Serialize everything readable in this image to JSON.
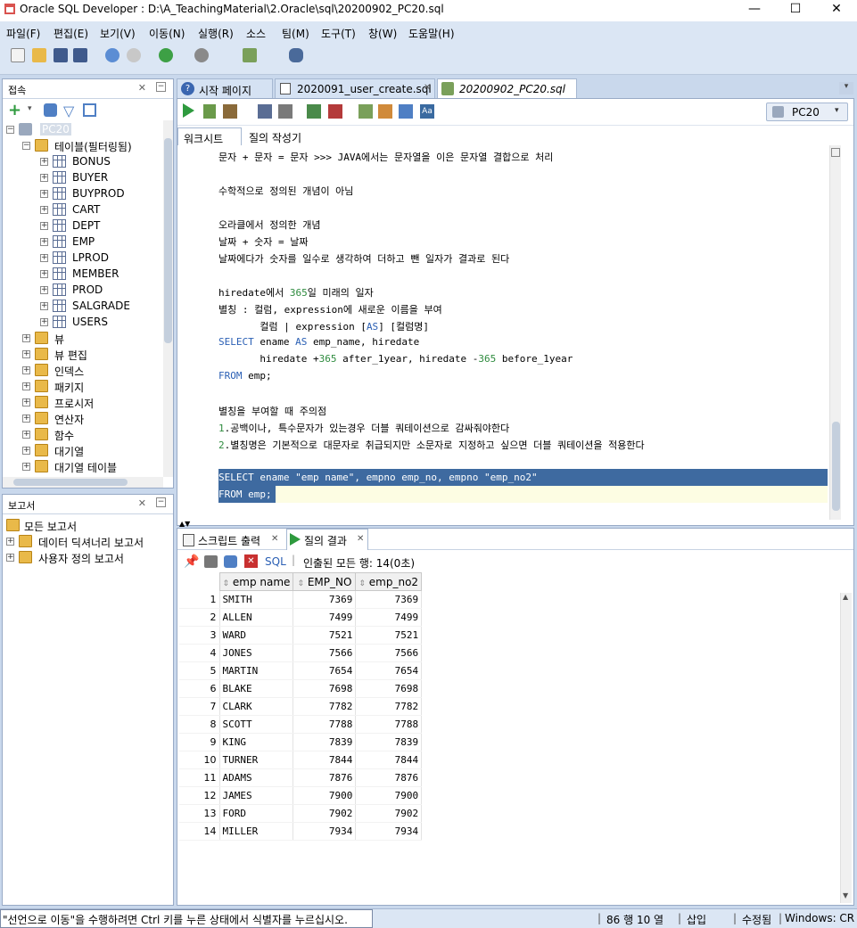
{
  "window": {
    "title": "Oracle SQL Developer : D:\\A_TeachingMaterial\\2.Oracle\\sql\\20200902_PC20.sql",
    "minimize": "—",
    "maximize": "☐",
    "close": "✕"
  },
  "menu": [
    "파일(F)",
    "편집(E)",
    "보기(V)",
    "이동(N)",
    "실행(R)",
    "소스",
    "팀(M)",
    "도구(T)",
    "창(W)",
    "도움말(H)"
  ],
  "connections_panel": {
    "title": "접속",
    "root": "PC20",
    "tables_node": "테이블(필터링됨)",
    "tables": [
      "BONUS",
      "BUYER",
      "BUYPROD",
      "CART",
      "DEPT",
      "EMP",
      "LPROD",
      "MEMBER",
      "PROD",
      "SALGRADE",
      "USERS"
    ],
    "other_nodes": [
      "뷰",
      "뷰 편집",
      "인덱스",
      "패키지",
      "프로시저",
      "연산자",
      "함수",
      "대기열",
      "대기열 테이블"
    ]
  },
  "reports_panel": {
    "title": "보고서",
    "items": [
      "모든 보고서",
      "데이터 딕셔너리 보고서",
      "사용자 정의 보고서"
    ]
  },
  "editor_tabs": [
    "시작 페이지",
    "2020091_user_create.sql",
    "20200902_PC20.sql"
  ],
  "connection_selector": "PC20",
  "subtabs": [
    "워크시트",
    "질의 작성기"
  ],
  "code_lines": [
    {
      "text": "문자 + 문자 = 문자 >>> JAVA에서는 문자열을 이은 문자열 결합으로 처리"
    },
    {
      "text": ""
    },
    {
      "text": "수학적으로 정의된 개념이 아님"
    },
    {
      "text": ""
    },
    {
      "text": "오라클에서 정의한 개념"
    },
    {
      "text": "날짜 + 숫자 = 날짜"
    },
    {
      "text": "날짜에다가 숫자를 일수로 생각하여 더하고 뺀 일자가 결과로 된다"
    },
    {
      "text": ""
    },
    {
      "text": "hiredate에서 365일 미래의 일자"
    },
    {
      "text": "별칭 : 컬럼, expression에 새로운 이름을 부여"
    },
    {
      "text": "       컬럼 | expression [AS] [컬럼명]"
    },
    {
      "text": "SELECT ename AS emp_name, hiredate"
    },
    {
      "text": "       hiredate +365 after_1year, hiredate -365 before_1year"
    },
    {
      "text": "FROM emp;"
    },
    {
      "text": ""
    },
    {
      "text": "별칭을 부여할 때 주의점"
    },
    {
      "text": "1.공백이나, 특수문자가 있는경우 더블 쿼테이션으로 감싸줘야한다"
    },
    {
      "text": "2.별칭명은 기본적으로 대문자로 취급되지만 소문자로 지정하고 싶으면 더블 쿼테이션을 적용한다"
    },
    {
      "text": ""
    },
    {
      "text": "SELECT ename \"emp name\", empno emp_no, empno \"emp_no2\""
    },
    {
      "text": "FROM emp;"
    }
  ],
  "result_tabs": [
    "스크립트 출력",
    "질의 결과"
  ],
  "result_toolbar": {
    "sql_label": "SQL",
    "fetched_text": "인출된 모든 행: 14(0초)"
  },
  "grid": {
    "columns": [
      "emp name",
      "EMP_NO",
      "emp_no2"
    ],
    "rows": [
      [
        "1",
        "SMITH",
        "7369",
        "7369"
      ],
      [
        "2",
        "ALLEN",
        "7499",
        "7499"
      ],
      [
        "3",
        "WARD",
        "7521",
        "7521"
      ],
      [
        "4",
        "JONES",
        "7566",
        "7566"
      ],
      [
        "5",
        "MARTIN",
        "7654",
        "7654"
      ],
      [
        "6",
        "BLAKE",
        "7698",
        "7698"
      ],
      [
        "7",
        "CLARK",
        "7782",
        "7782"
      ],
      [
        "8",
        "SCOTT",
        "7788",
        "7788"
      ],
      [
        "9",
        "KING",
        "7839",
        "7839"
      ],
      [
        "10",
        "TURNER",
        "7844",
        "7844"
      ],
      [
        "11",
        "ADAMS",
        "7876",
        "7876"
      ],
      [
        "12",
        "JAMES",
        "7900",
        "7900"
      ],
      [
        "13",
        "FORD",
        "7902",
        "7902"
      ],
      [
        "14",
        "MILLER",
        "7934",
        "7934"
      ]
    ]
  },
  "statusbar": {
    "message": "\"선언으로 이동\"을 수행하려면 Ctrl 키를 누른 상태에서 식별자를 누르십시오.",
    "position": "86 행 10 열",
    "mode": "삽입",
    "modified": "수정됨",
    "line_ending": "Windows: CR"
  },
  "colors": {
    "accent": "#3e6aa0",
    "keyword": "#2a5fb4",
    "number": "#2e8b3e",
    "chrome": "#dbe6f4"
  }
}
